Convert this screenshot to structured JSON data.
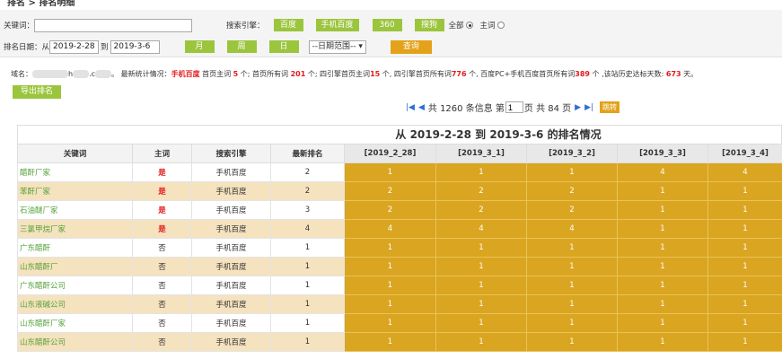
{
  "breadcrumb": "排名 > 排名明细",
  "search": {
    "keyword_label": "关键词：",
    "keyword_value": "",
    "engine_label": "搜索引擎：",
    "engines": [
      "百度",
      "手机百度",
      "360",
      "搜狗"
    ],
    "all_label": "全部",
    "main_label": "主词",
    "date_label": "排名日期：从",
    "date_from": "2019-2-28",
    "to_label": "到",
    "date_to": "2019-3-6",
    "period_buttons": [
      "月",
      "周",
      "日"
    ],
    "range_select": "--日期范围--",
    "query_button": "查询"
  },
  "stats": {
    "domain_label": "域名：",
    "domain_visible_1": "h",
    "domain_visible_2": ".c",
    "p1": "。 最新统计情况：",
    "engine": "手机百度",
    "p2": " 首页主词 ",
    "home_main": "5",
    "p3": " 个; 首页所有词 ",
    "home_all": "201",
    "p4": " 个; 四引擎首页主词",
    "four_main": "15",
    "p5": " 个, 四引擎首页所有词",
    "four_all": "776",
    "p6": " 个, 百度PC+手机百度首页所有词",
    "pc_mobile_all": "389",
    "p7": " 个 ,该站历史达标天数: ",
    "days": "673",
    "p8": " 天。"
  },
  "export_button": "导出排名",
  "pager": {
    "first": "|◀",
    "prev": "◀",
    "text_total": "共 1260 条信息 第",
    "page_value": "1",
    "text_pages": "页 共 84 页",
    "next": "▶",
    "last": "▶|",
    "go": "跳转"
  },
  "table": {
    "title": "从 2019-2-28 到 2019-3-6 的排名情况",
    "headers": [
      "关键词",
      "主词",
      "搜索引擎",
      "最新排名",
      "[2019_2_28]",
      "[2019_3_1]",
      "[2019_3_2]",
      "[2019_3_3]",
      "[2019_3_4]"
    ],
    "rows": [
      [
        "醋酐厂家",
        "是",
        "手机百度",
        "2",
        "1",
        "1",
        "1",
        "4",
        "4"
      ],
      [
        "苯酐厂家",
        "是",
        "手机百度",
        "2",
        "2",
        "2",
        "2",
        "1",
        "1"
      ],
      [
        "石油醚厂家",
        "是",
        "手机百度",
        "3",
        "2",
        "2",
        "2",
        "1",
        "1"
      ],
      [
        "三氯甲烷厂家",
        "是",
        "手机百度",
        "4",
        "4",
        "4",
        "4",
        "1",
        "1"
      ],
      [
        "广东醋酐",
        "否",
        "手机百度",
        "1",
        "1",
        "1",
        "1",
        "1",
        "1"
      ],
      [
        "山东醋酐厂",
        "否",
        "手机百度",
        "1",
        "1",
        "1",
        "1",
        "1",
        "1"
      ],
      [
        "广东醋酐公司",
        "否",
        "手机百度",
        "1",
        "1",
        "1",
        "1",
        "1",
        "1"
      ],
      [
        "山东液碱公司",
        "否",
        "手机百度",
        "1",
        "1",
        "1",
        "1",
        "1",
        "1"
      ],
      [
        "山东醋酐厂家",
        "否",
        "手机百度",
        "1",
        "1",
        "1",
        "1",
        "1",
        "1"
      ],
      [
        "山东醋酐公司",
        "否",
        "手机百度",
        "1",
        "1",
        "1",
        "1",
        "1",
        "1"
      ]
    ]
  },
  "colors": {
    "green_button": "#9bc53d",
    "orange_button": "#e3a21a",
    "gold_cell": "#daa520",
    "alt_row": "#f5e2be",
    "highlight_red": "#e31b1b"
  }
}
